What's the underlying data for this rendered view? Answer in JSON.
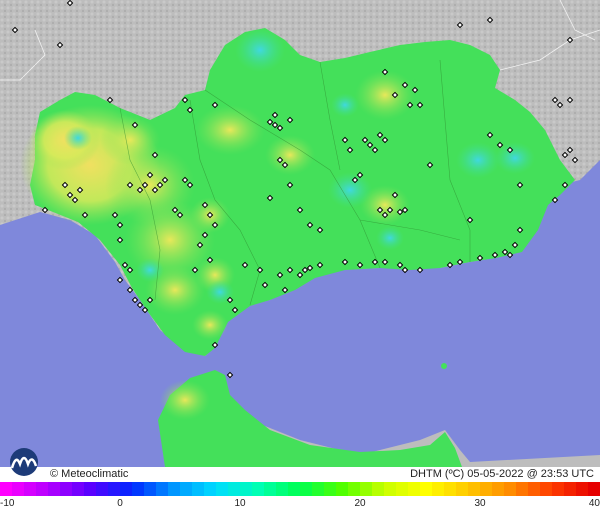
{
  "legend": {
    "brand_label": "© Meteoclimatic",
    "logo_icon": "meteoclimatic-logo-icon",
    "title": "DHTM (ºC) 05-05-2022 @ 23:53 UTC",
    "scale_min": -10,
    "scale_max": 40,
    "tick_labels": [
      "-10",
      "0",
      "10",
      "20",
      "30",
      "40"
    ],
    "stops": [
      "#ff00ff",
      "#b400ff",
      "#5a00ff",
      "#0028ff",
      "#0096ff",
      "#00dcff",
      "#00ffb4",
      "#00ff50",
      "#50ff00",
      "#c8ff00",
      "#ffff00",
      "#ffc800",
      "#ff8c00",
      "#ff3c00",
      "#e60000"
    ]
  },
  "map": {
    "sea_color": "#7f88db",
    "land_outside_color": "#b9b9b9",
    "region_base_color": "#44e05a",
    "hot_color": "#e6e85a",
    "cool_color": "#40d6c8",
    "station_icon": "station-marker-icon"
  }
}
